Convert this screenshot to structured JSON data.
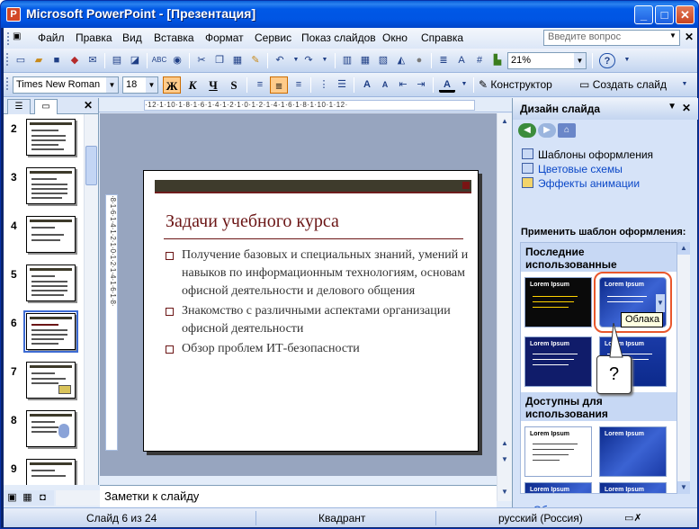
{
  "window": {
    "title": "Microsoft PowerPoint - [Презентация]",
    "app_icon": "P",
    "min": "_",
    "max": "□",
    "close": "✕"
  },
  "menu": {
    "items": [
      "Файл",
      "Правка",
      "Вид",
      "Вставка",
      "Формат",
      "Сервис",
      "Показ слайдов",
      "Окно",
      "Справка"
    ],
    "help_placeholder": "Введите вопрос",
    "close_glyph": "✕"
  },
  "toolbar": {
    "zoom": "21%",
    "help_glyph": "?"
  },
  "format": {
    "font": "Times New Roman",
    "size": "18",
    "bold": "Ж",
    "italic": "К",
    "underline": "Ч",
    "shadow": "S",
    "designer_label": "Конструктор",
    "new_slide_label": "Создать слайд"
  },
  "thumbnails": [
    {
      "num": "2"
    },
    {
      "num": "3"
    },
    {
      "num": "4"
    },
    {
      "num": "5"
    },
    {
      "num": "6"
    },
    {
      "num": "7"
    },
    {
      "num": "8"
    },
    {
      "num": "9"
    }
  ],
  "slide": {
    "title": "Задачи учебного курса",
    "bullets": [
      "Получение базовых и специальных знаний, умений и навыков по информационным технологиям, основам офисной деятельности и делового общения",
      "Знакомство с различными аспектами организации офисной деятельности",
      "Обзор проблем ИТ-безопасности"
    ]
  },
  "notes": {
    "placeholder": "Заметки к слайду"
  },
  "taskpane": {
    "title": "Дизайн слайда",
    "links": {
      "templates": "Шаблоны оформления",
      "color_schemes": "Цветовые схемы",
      "animation": "Эффекты анимации"
    },
    "apply_label": "Применить шаблон оформления:",
    "section_recent": "Последние использованные",
    "section_available": "Доступны для использования",
    "template_text": "Lorem Ipsum",
    "tooltip": "Облака",
    "callout": "?",
    "browse": "Обзор..."
  },
  "status": {
    "slide": "Слайд 6 из 24",
    "design": "Квадрант",
    "language": "русский (Россия)"
  },
  "colors": {
    "title_blue": "#0058e6",
    "accent_orange": "#e9572c",
    "slide_title": "#6b1515"
  }
}
